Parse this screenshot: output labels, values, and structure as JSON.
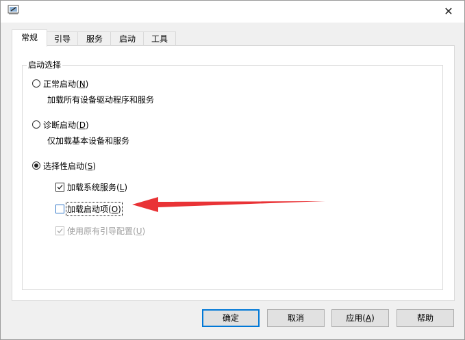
{
  "titlebar": {
    "close_glyph": "✕",
    "app_icon": "msconfig-icon"
  },
  "tabs": [
    {
      "label": "常规",
      "active": true
    },
    {
      "label": "引导",
      "active": false
    },
    {
      "label": "服务",
      "active": false
    },
    {
      "label": "启动",
      "active": false
    },
    {
      "label": "工具",
      "active": false
    }
  ],
  "group": {
    "title": "启动选择",
    "normal": {
      "label": "正常启动(",
      "key": "N",
      "suffix": ")",
      "desc": "加载所有设备驱动程序和服务",
      "checked": false
    },
    "diagnostic": {
      "label": "诊断启动(",
      "key": "D",
      "suffix": ")",
      "desc": "仅加载基本设备和服务",
      "checked": false
    },
    "selective": {
      "label": "选择性启动(",
      "key": "S",
      "suffix": ")",
      "checked": true
    },
    "load_services": {
      "label": "加载系统服务(",
      "key": "L",
      "suffix": ")",
      "checked": true
    },
    "load_startup": {
      "label": "加载启动项(",
      "key": "O",
      "suffix": ")",
      "checked": false
    },
    "original_boot": {
      "label": "使用原有引导配置(",
      "key": "U",
      "suffix": ")",
      "checked": true,
      "disabled": true
    }
  },
  "buttons": {
    "ok": "确定",
    "cancel": "取消",
    "apply_label": "应用(",
    "apply_key": "A",
    "apply_suffix": ")",
    "help": "帮助"
  },
  "colors": {
    "accent": "#0078d7",
    "annotation_arrow": "#e8282b"
  }
}
